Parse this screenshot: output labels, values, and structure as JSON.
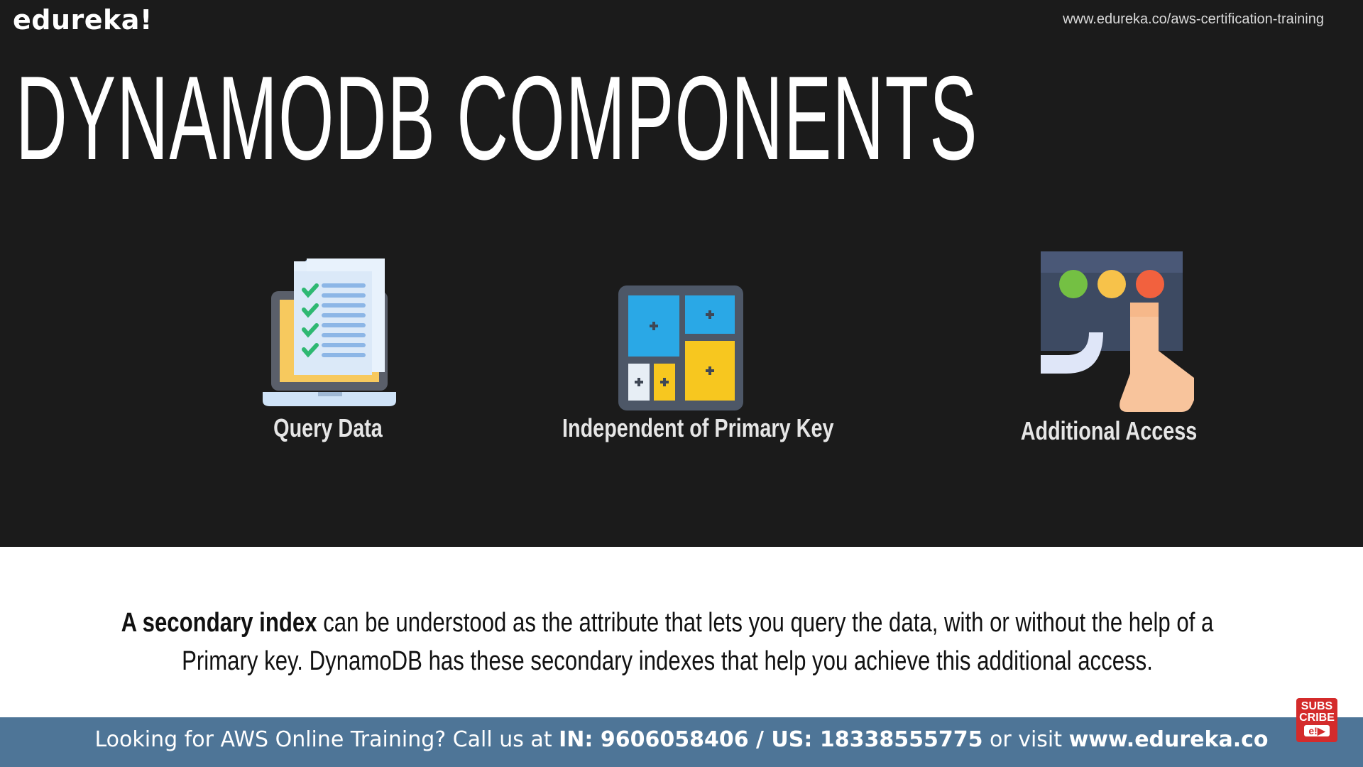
{
  "header": {
    "logo": "edureka!",
    "url": "www.edureka.co/aws-certification-training"
  },
  "slide": {
    "title": "DYNAMODB COMPONENTS",
    "components": [
      {
        "label": "Query Data",
        "icon": "checklist-laptop-icon"
      },
      {
        "label": "Independent of Primary Key",
        "icon": "grid-blocks-icon"
      },
      {
        "label": "Additional Access",
        "icon": "hand-tap-panel-icon"
      }
    ],
    "description": {
      "bold": "A secondary index",
      "rest": " can be understood as the attribute that lets you query the data, with or without the help of a Primary key. DynamoDB has these secondary indexes that help you achieve this additional access."
    }
  },
  "footer": {
    "prefix": "Looking for AWS Online Training? Call us at ",
    "phones": "IN: 9606058406 / US: 18338555775",
    "middle": " or visit ",
    "site": "www.edureka.co",
    "subscribe_top": "SUBS",
    "subscribe_mid": "CRIBE",
    "subscribe_logo": "e!▶"
  },
  "colors": {
    "background": "#1b1b1b",
    "footer": "#4e7597",
    "white_panel": "#ffffff",
    "subscribe": "#d42b2b"
  }
}
